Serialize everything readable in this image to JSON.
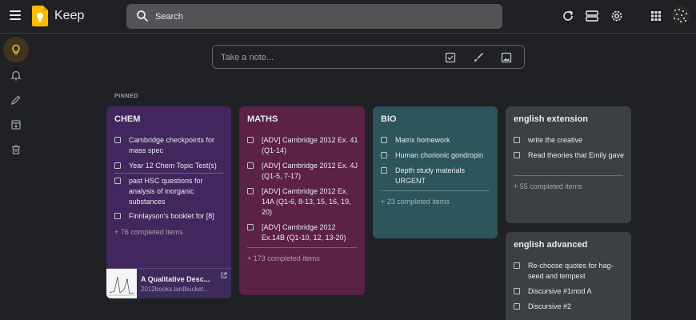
{
  "header": {
    "app_title": "Keep",
    "search_placeholder": "Search",
    "icons": [
      "menu-icon",
      "refresh-icon",
      "list-view-icon",
      "settings-icon",
      "apps-icon"
    ]
  },
  "sidebar": {
    "items": [
      {
        "name": "notes",
        "icon": "lightbulb-icon",
        "active": true
      },
      {
        "name": "reminders",
        "icon": "bell-icon"
      },
      {
        "name": "edit-labels",
        "icon": "pencil-icon"
      },
      {
        "name": "archive",
        "icon": "archive-icon"
      },
      {
        "name": "trash",
        "icon": "trash-icon"
      }
    ]
  },
  "take_note": {
    "placeholder": "Take a note...",
    "icons": [
      "checkbox-icon",
      "brush-icon",
      "image-icon"
    ]
  },
  "pinned_label": "PINNED",
  "colors": {
    "background": "#202124",
    "chem": "#42275e",
    "maths": "#5b2245",
    "bio": "#2d555e",
    "english": "#3c3f43",
    "logo": "#fbbc04"
  },
  "notes": {
    "chem": {
      "title": "CHEM",
      "items": [
        "Cambridge checkpoints for mass spec",
        "Year 12 Chem Topic Test(s)",
        "past HSC questions for analysis of inorganic substances",
        "Finnlayson's booklet for [8]"
      ],
      "completed": "+ 76 completed items",
      "link": {
        "title": "A Qualitative Desc...",
        "url": "2012books.lardbucket..."
      }
    },
    "maths": {
      "title": "MATHS",
      "items": [
        "[ADV] Cambridge 2012 Ex. 41 (Q1-14)",
        "[ADV] Cambridge 2012 Ex. 4J (Q1-5,  7-17)",
        "[ADV]  Cambridge 2012 Ex. 14A (Q1-6, 8-13, 15, 16, 19, 20)",
        "[ADV] Cambridge 2012 Ex.14B (Q1-10, 12, 13-20)"
      ],
      "completed": "+ 173 completed items"
    },
    "bio": {
      "title": "BIO",
      "items": [
        "Matrix homework",
        "Human chorionic gondropin",
        "Depth study materials URGENT"
      ],
      "completed": "+ 23 completed items"
    },
    "english_extension": {
      "title": "english extension",
      "items": [
        "write the creative",
        "Read theories that Emily gave"
      ],
      "completed": "+ 55 completed items"
    },
    "english_advanced": {
      "title": "english advanced",
      "items": [
        "Re-choose quotes for hag-seed and tempest",
        "Discursive #1mod A",
        "Discursive #2"
      ]
    }
  }
}
